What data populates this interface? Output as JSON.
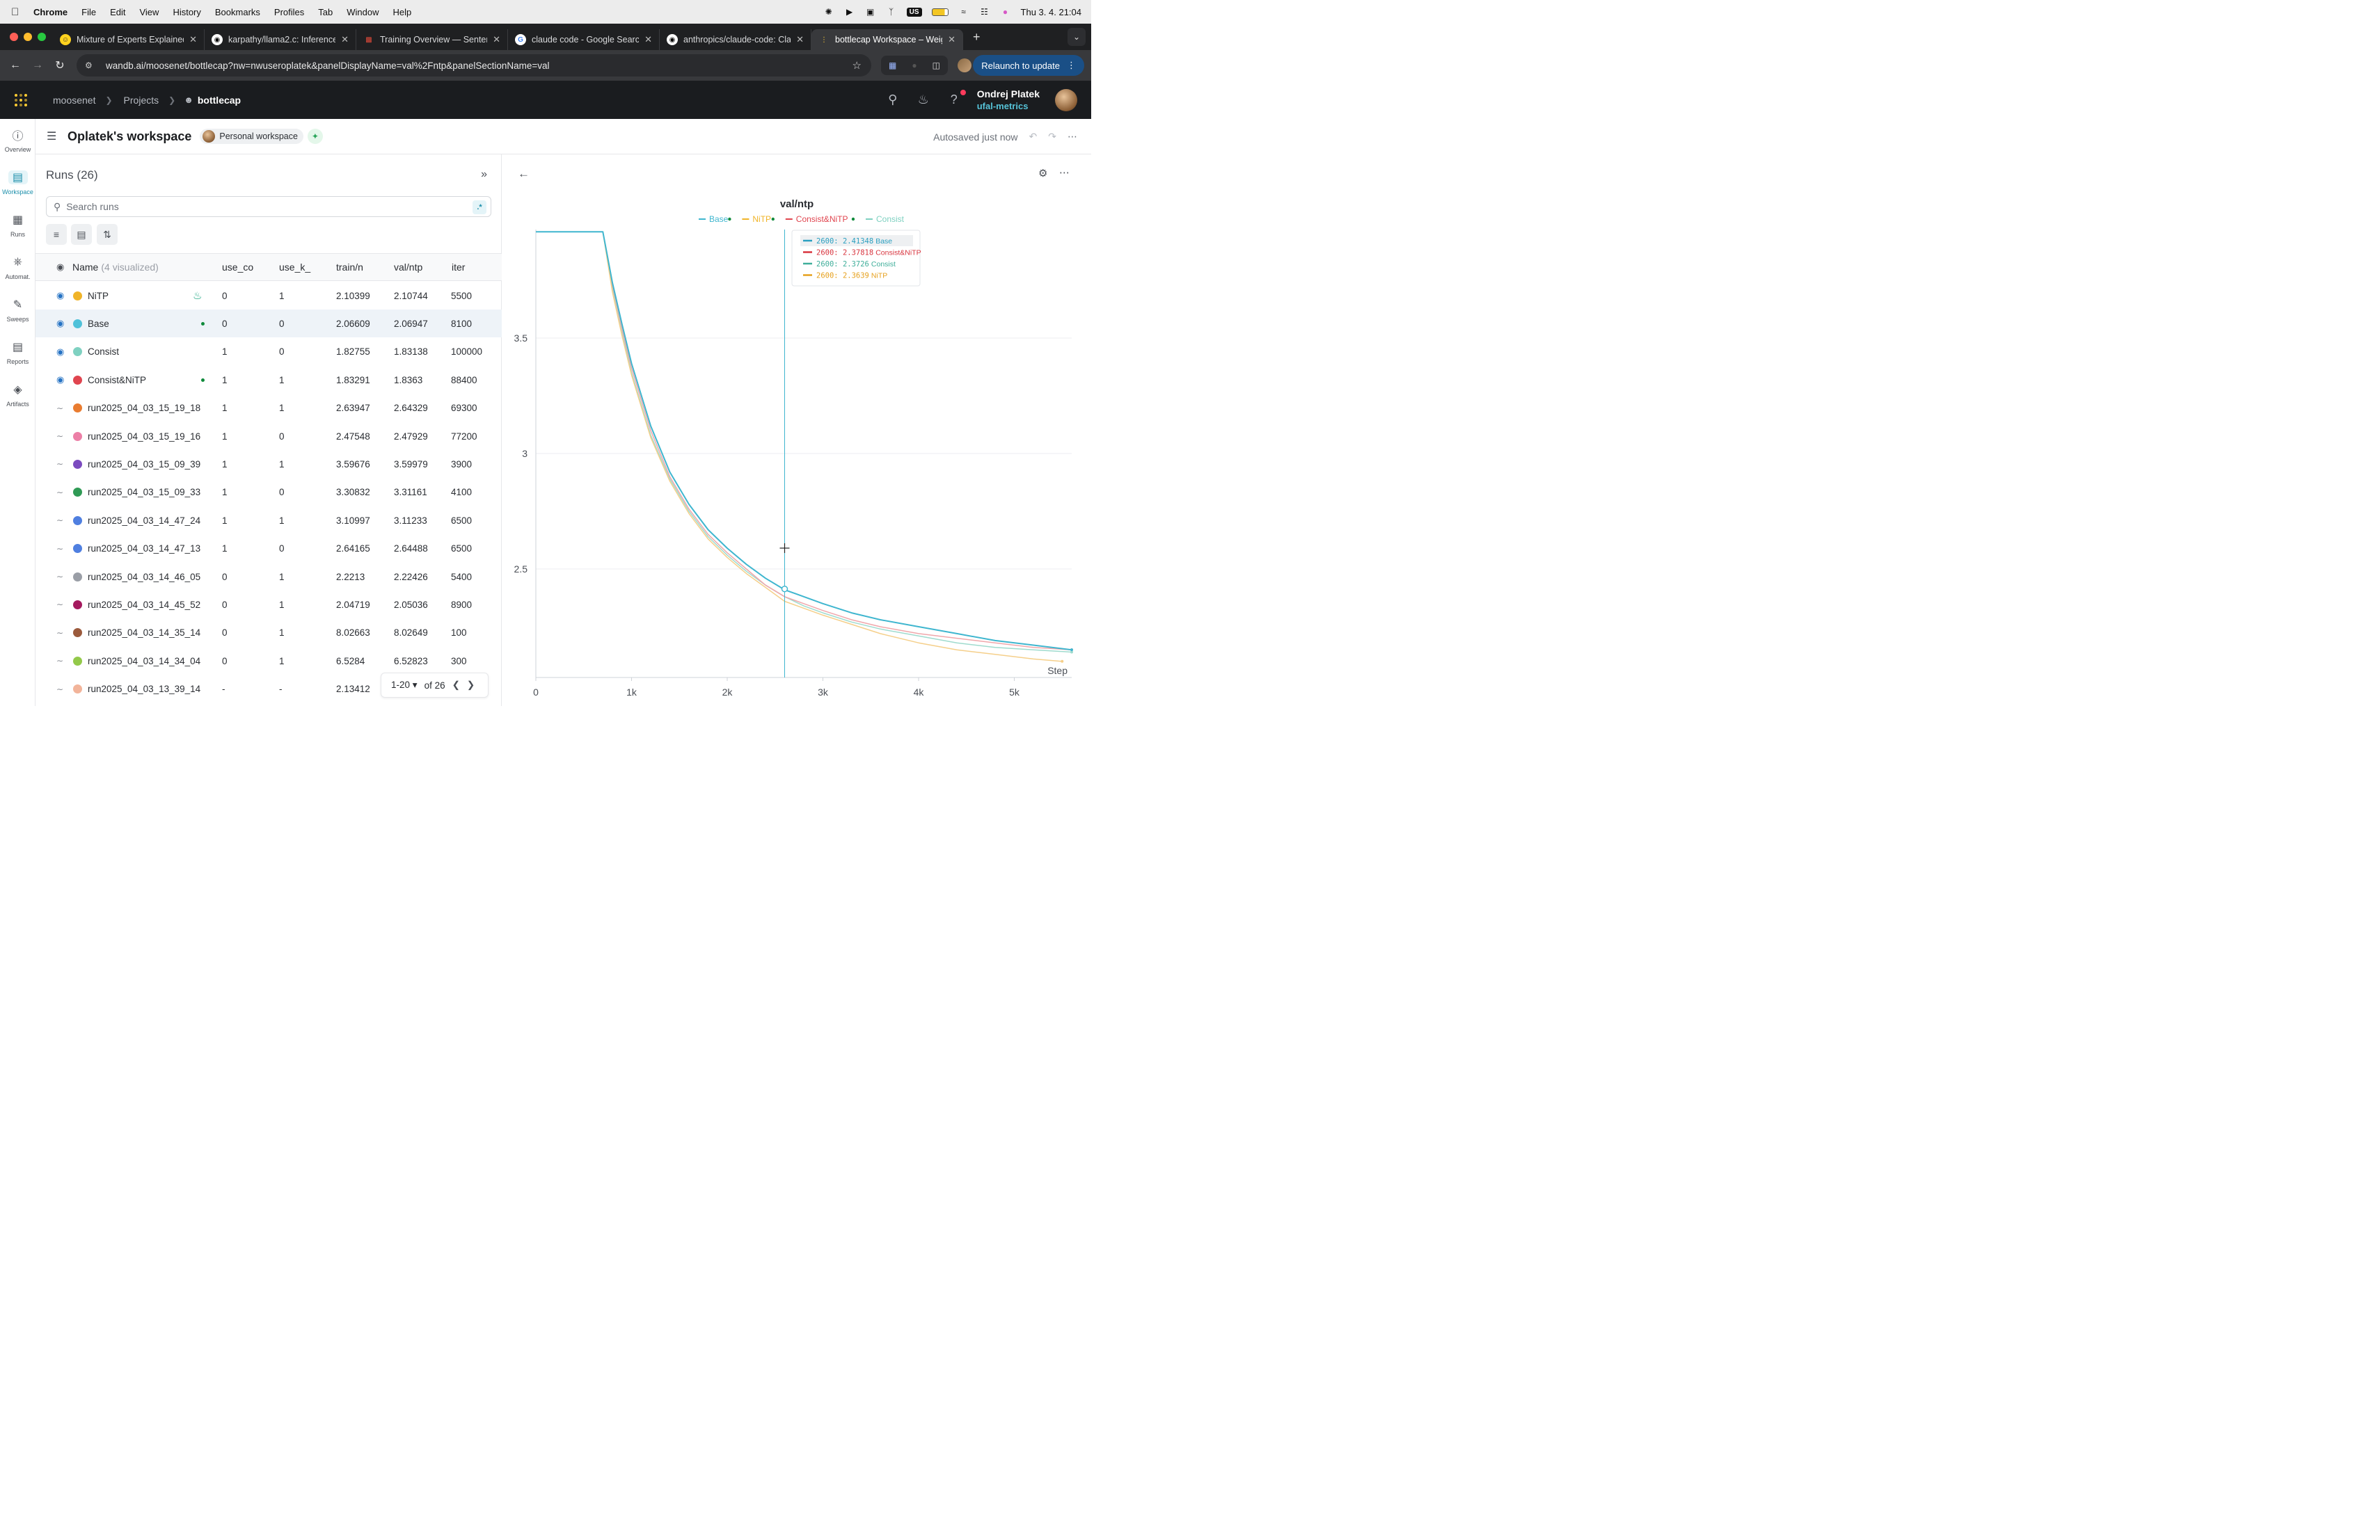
{
  "menubar": {
    "app": "Chrome",
    "items": [
      "File",
      "Edit",
      "View",
      "History",
      "Bookmarks",
      "Profiles",
      "Tab",
      "Window",
      "Help"
    ],
    "input_source": "US",
    "clock": "Thu 3. 4.  21:04"
  },
  "tabs": [
    {
      "title": "Mixture of Experts Explained",
      "icon": "hf-icon",
      "active": false
    },
    {
      "title": "karpathy/llama2.c: Inference L",
      "icon": "github-icon",
      "active": false
    },
    {
      "title": "Training Overview — Sentenc",
      "icon": "sbert-icon",
      "active": false
    },
    {
      "title": "claude code - Google Search",
      "icon": "google-icon",
      "active": false
    },
    {
      "title": "anthropics/claude-code: Clau",
      "icon": "github-icon",
      "active": false
    },
    {
      "title": "bottlecap Workspace – Weigh",
      "icon": "wandb-icon",
      "active": true
    }
  ],
  "address": {
    "url": "wandb.ai/moosenet/bottlecap?nw=nwuseroplatek&panelDisplayName=val%2Fntp&panelSectionName=val",
    "relaunch_label": "Relaunch to update"
  },
  "header": {
    "breadcrumb": [
      "moosenet",
      "Projects",
      "bottlecap"
    ],
    "user_name": "Ondrej Platek",
    "user_entity": "ufal-metrics"
  },
  "leftnav": [
    {
      "label": "Overview",
      "icon": "info-icon"
    },
    {
      "label": "Workspace",
      "icon": "workspace-icon",
      "active": true
    },
    {
      "label": "Runs",
      "icon": "table-icon"
    },
    {
      "label": "Automat.",
      "icon": "automation-icon"
    },
    {
      "label": "Sweeps",
      "icon": "broom-icon"
    },
    {
      "label": "Reports",
      "icon": "report-icon"
    },
    {
      "label": "Artifacts",
      "icon": "layers-icon"
    }
  ],
  "workspace": {
    "title": "Oplatek's workspace",
    "badge": "Personal workspace",
    "autosave": "Autosaved just now"
  },
  "runs": {
    "title": "Runs (26)",
    "search_placeholder": "Search runs",
    "regex_label": ".*",
    "columns": {
      "name": "Name",
      "name_note": "(4 visualized)",
      "c1": "use_co",
      "c2": "use_k_",
      "c3": "train/n",
      "c4": "val/ntp",
      "c5": "iter"
    },
    "rows": [
      {
        "name": "NiTP",
        "color": "#f0b429",
        "visible": true,
        "c1": "0",
        "c2": "1",
        "c3": "2.10399",
        "c4": "2.10744",
        "c5": "5500",
        "marker": "bell"
      },
      {
        "name": "Base",
        "color": "#4fc1d9",
        "visible": true,
        "c1": "0",
        "c2": "0",
        "c3": "2.06609",
        "c4": "2.06947",
        "c5": "8100",
        "marker": "dot",
        "selected": true
      },
      {
        "name": "Consist",
        "color": "#7fd1c1",
        "visible": true,
        "c1": "1",
        "c2": "0",
        "c3": "1.82755",
        "c4": "1.83138",
        "c5": "100000",
        "marker": ""
      },
      {
        "name": "Consist&NiTP",
        "color": "#e0454f",
        "visible": true,
        "c1": "1",
        "c2": "1",
        "c3": "1.83291",
        "c4": "1.8363",
        "c5": "88400",
        "marker": "dot"
      },
      {
        "name": "run2025_04_03_15_19_18",
        "color": "#e97c30",
        "visible": false,
        "c1": "1",
        "c2": "1",
        "c3": "2.63947",
        "c4": "2.64329",
        "c5": "69300",
        "marker": ""
      },
      {
        "name": "run2025_04_03_15_19_16",
        "color": "#ec7fa6",
        "visible": false,
        "c1": "1",
        "c2": "0",
        "c3": "2.47548",
        "c4": "2.47929",
        "c5": "77200",
        "marker": ""
      },
      {
        "name": "run2025_04_03_15_09_39",
        "color": "#7b4bbf",
        "visible": false,
        "c1": "1",
        "c2": "1",
        "c3": "3.59676",
        "c4": "3.59979",
        "c5": "3900",
        "marker": ""
      },
      {
        "name": "run2025_04_03_15_09_33",
        "color": "#2f9a55",
        "visible": false,
        "c1": "1",
        "c2": "0",
        "c3": "3.30832",
        "c4": "3.31161",
        "c5": "4100",
        "marker": ""
      },
      {
        "name": "run2025_04_03_14_47_24",
        "color": "#4f7fe0",
        "visible": false,
        "c1": "1",
        "c2": "1",
        "c3": "3.10997",
        "c4": "3.11233",
        "c5": "6500",
        "marker": ""
      },
      {
        "name": "run2025_04_03_14_47_13",
        "color": "#4f7fe0",
        "visible": false,
        "c1": "1",
        "c2": "0",
        "c3": "2.64165",
        "c4": "2.64488",
        "c5": "6500",
        "marker": ""
      },
      {
        "name": "run2025_04_03_14_46_05",
        "color": "#9a9ea6",
        "visible": false,
        "c1": "0",
        "c2": "1",
        "c3": "2.2213",
        "c4": "2.22426",
        "c5": "5400",
        "marker": ""
      },
      {
        "name": "run2025_04_03_14_45_52",
        "color": "#a4195e",
        "visible": false,
        "c1": "0",
        "c2": "1",
        "c3": "2.04719",
        "c4": "2.05036",
        "c5": "8900",
        "marker": ""
      },
      {
        "name": "run2025_04_03_14_35_14",
        "color": "#9b5a3c",
        "visible": false,
        "c1": "0",
        "c2": "1",
        "c3": "8.02663",
        "c4": "8.02649",
        "c5": "100",
        "marker": ""
      },
      {
        "name": "run2025_04_03_14_34_04",
        "color": "#93c94a",
        "visible": false,
        "c1": "0",
        "c2": "1",
        "c3": "6.5284",
        "c4": "6.52823",
        "c5": "300",
        "marker": ""
      },
      {
        "name": "run2025_04_03_13_39_14",
        "color": "#f2b49a",
        "visible": false,
        "c1": "-",
        "c2": "-",
        "c3": "2.13412",
        "c4": "",
        "c5": "",
        "marker": ""
      }
    ],
    "pager": {
      "range": "1-20",
      "of": "of 26"
    }
  },
  "chart_data": {
    "type": "line",
    "title": "val/ntp",
    "xlabel": "Step",
    "ylabel": "",
    "xlim": [
      0,
      5600
    ],
    "ylim": [
      2.03,
      3.97
    ],
    "xticks": [
      0,
      1000,
      2000,
      3000,
      4000,
      5000
    ],
    "xtick_labels": [
      "0",
      "1k",
      "2k",
      "3k",
      "4k",
      "5k"
    ],
    "yticks": [
      2.5,
      3,
      3.5
    ],
    "ytick_labels": [
      "2.5",
      "3",
      "3.5"
    ],
    "grid": true,
    "legend_position": "top",
    "legend": [
      {
        "name": "Base",
        "color": "#3fb6cf",
        "dot": true
      },
      {
        "name": "NiTP",
        "color": "#f0b429",
        "dot": true
      },
      {
        "name": "Consist&NiTP",
        "color": "#e0454f",
        "dot": true
      },
      {
        "name": "Consist",
        "color": "#7fd1c1",
        "dot": false
      }
    ],
    "hover_step": 2600,
    "tooltip": [
      {
        "step": "2600",
        "value": "2.41348",
        "name": "Base",
        "color": "#2a9fc0"
      },
      {
        "step": "2600",
        "value": "2.37818",
        "name": "Consist&NiTP",
        "color": "#d8343e"
      },
      {
        "step": "2600",
        "value": "2.3726",
        "name": "Consist",
        "color": "#3fae9a"
      },
      {
        "step": "2600",
        "value": "2.3639",
        "name": "NiTP",
        "color": "#e6a01c"
      }
    ],
    "series": [
      {
        "name": "Consist",
        "color": "#9fdbce",
        "x": [
          0,
          700,
          800,
          900,
          1000,
          1200,
          1400,
          1600,
          1800,
          2000,
          2200,
          2400,
          2600,
          2800,
          3000,
          3300,
          3600,
          4000,
          4400,
          4800,
          5200,
          5600
        ],
        "y": [
          3.96,
          3.96,
          3.72,
          3.53,
          3.35,
          3.08,
          2.89,
          2.75,
          2.64,
          2.56,
          2.49,
          2.43,
          2.38,
          2.34,
          2.31,
          2.27,
          2.24,
          2.21,
          2.18,
          2.16,
          2.15,
          2.14
        ]
      },
      {
        "name": "Consist&NiTP",
        "color": "#f0a7ab",
        "x": [
          0,
          700,
          800,
          900,
          1000,
          1200,
          1400,
          1600,
          1800,
          2000,
          2200,
          2400,
          2600,
          2800,
          3000,
          3300,
          3600,
          4000,
          4400,
          4800,
          5200,
          5600
        ],
        "y": [
          3.96,
          3.96,
          3.73,
          3.54,
          3.37,
          3.1,
          2.9,
          2.76,
          2.65,
          2.57,
          2.5,
          2.43,
          2.38,
          2.35,
          2.32,
          2.28,
          2.25,
          2.22,
          2.2,
          2.18,
          2.16,
          2.15
        ]
      },
      {
        "name": "NiTP",
        "color": "#f5cf8a",
        "x": [
          0,
          700,
          800,
          900,
          1000,
          1200,
          1400,
          1600,
          1800,
          2000,
          2200,
          2400,
          2600,
          2800,
          3000,
          3300,
          3600,
          4000,
          4400,
          4800,
          5200,
          5500
        ],
        "y": [
          3.96,
          3.96,
          3.7,
          3.51,
          3.34,
          3.07,
          2.88,
          2.74,
          2.63,
          2.55,
          2.48,
          2.42,
          2.36,
          2.33,
          2.3,
          2.26,
          2.22,
          2.18,
          2.15,
          2.13,
          2.11,
          2.1
        ]
      },
      {
        "name": "Base",
        "color": "#3fb6cf",
        "x": [
          0,
          700,
          800,
          900,
          1000,
          1200,
          1400,
          1600,
          1800,
          2000,
          2200,
          2300,
          2400,
          2600,
          2800,
          3000,
          3300,
          3600,
          4000,
          4400,
          4800,
          5200,
          5600
        ],
        "y": [
          3.96,
          3.96,
          3.74,
          3.56,
          3.39,
          3.12,
          2.92,
          2.78,
          2.67,
          2.59,
          2.52,
          2.49,
          2.46,
          2.41,
          2.38,
          2.35,
          2.31,
          2.28,
          2.25,
          2.22,
          2.19,
          2.17,
          2.15
        ]
      }
    ]
  }
}
